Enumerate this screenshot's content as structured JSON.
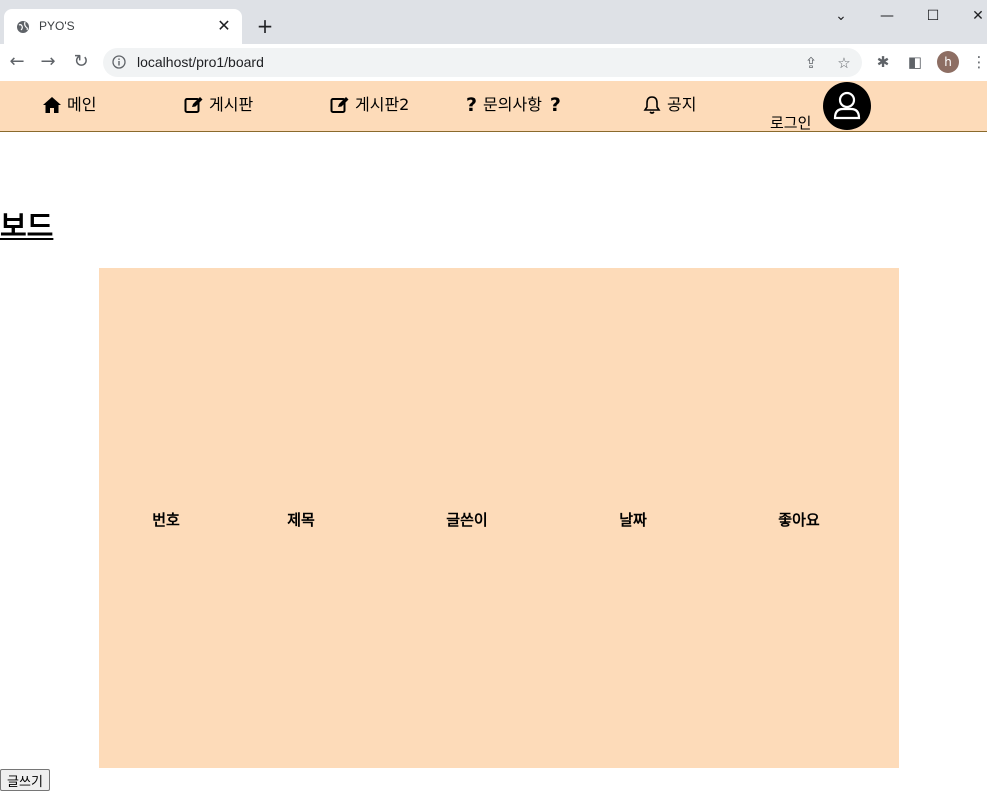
{
  "browser": {
    "tab_title": "PYO'S",
    "url": "localhost/pro1/board",
    "profile_initial": "h"
  },
  "site_nav": {
    "items": [
      {
        "label": "메인",
        "icon": "home-icon"
      },
      {
        "label": "게시판",
        "icon": "edit-icon"
      },
      {
        "label": "게시판2",
        "icon": "edit-icon"
      },
      {
        "label": "문의사항",
        "icon": "question-icon"
      },
      {
        "label": "공지",
        "icon": "bell-icon"
      }
    ],
    "login_label": "로그인"
  },
  "page": {
    "title": "보드"
  },
  "board": {
    "columns": [
      "번호",
      "제목",
      "글쓴이",
      "날짜",
      "좋아요"
    ]
  },
  "write_button": "글쓰기",
  "colors": {
    "nav_bg": "#fddbb9",
    "board_bg": "#fddbb9"
  }
}
